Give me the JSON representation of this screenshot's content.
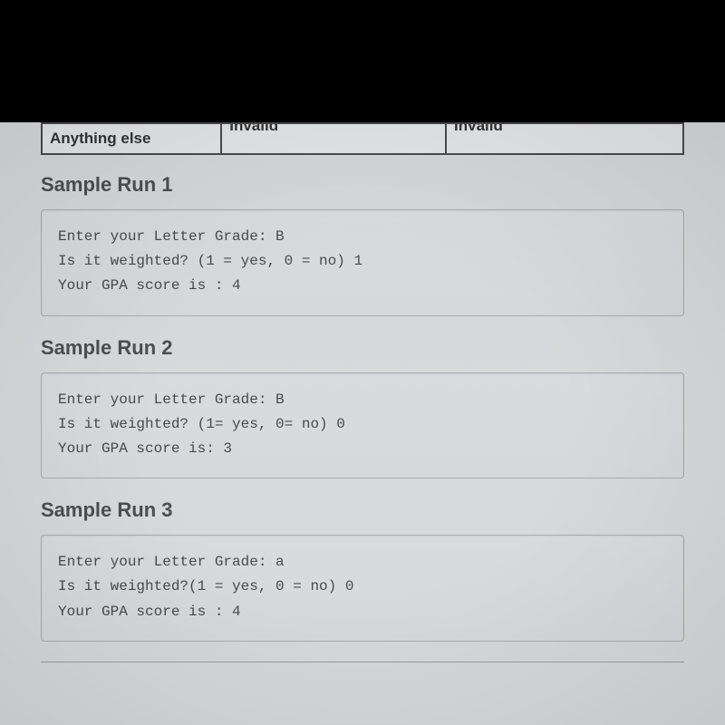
{
  "table": {
    "row": {
      "c1": "Anything else",
      "c2": "Invalid",
      "c3": "Invalid"
    }
  },
  "runs": [
    {
      "heading": "Sample Run 1",
      "lines": [
        "Enter your Letter Grade: B",
        "Is it weighted? (1 = yes, 0 = no) 1",
        "Your GPA score is : 4"
      ]
    },
    {
      "heading": "Sample Run 2",
      "lines": [
        "Enter your Letter Grade: B",
        "Is it weighted? (1= yes, 0= no) 0",
        "Your GPA score is: 3"
      ]
    },
    {
      "heading": "Sample Run 3",
      "lines": [
        "Enter your Letter Grade: a",
        "Is it weighted?(1 = yes, 0 = no) 0",
        "Your GPA score is : 4"
      ]
    }
  ]
}
